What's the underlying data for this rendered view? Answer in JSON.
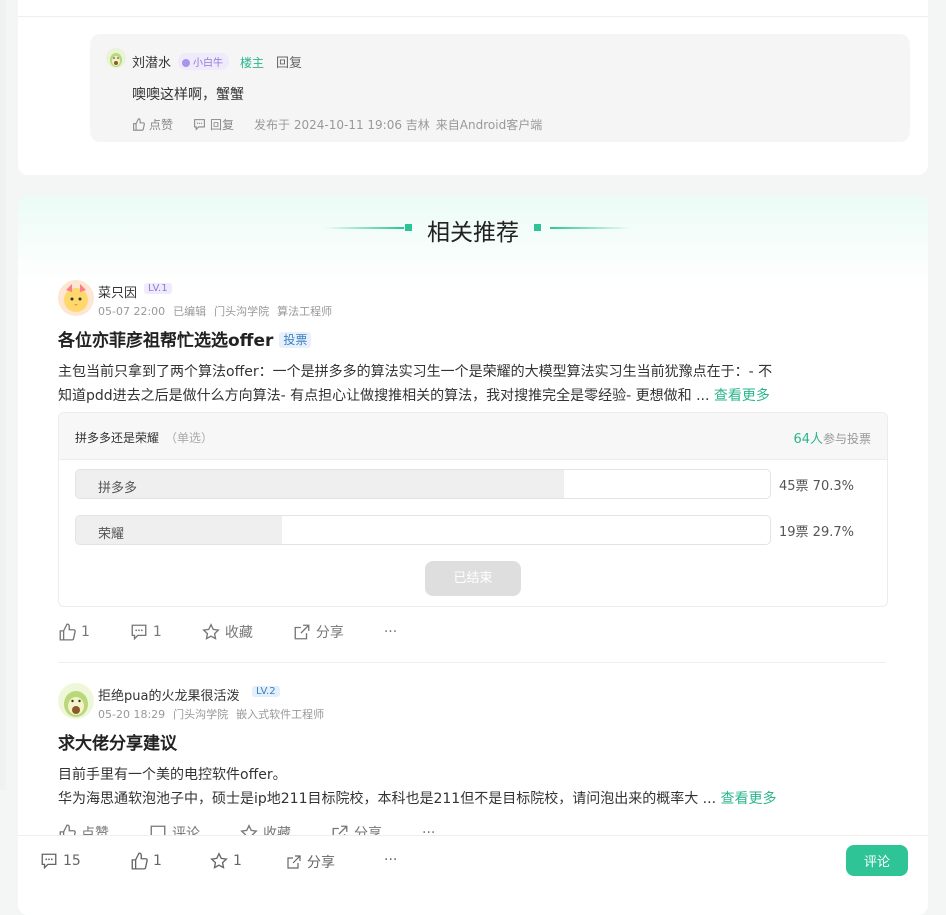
{
  "reply": {
    "username": "刘潜水",
    "badge": "小白牛",
    "role_tag": "楼主",
    "reply_link": "回复",
    "content": "噢噢这样啊，蟹蟹",
    "like_label": "点赞",
    "reply_label": "回复",
    "published": "发布于 2024-10-11 19:06 吉林",
    "client": "来自Android客户端"
  },
  "section": {
    "title": "相关推荐",
    "accent": "#2cc496"
  },
  "posts": [
    {
      "username": "菜只因",
      "level": "LV.1",
      "date": "05-07 22:00",
      "edited": "已编辑",
      "school": "门头沟学院",
      "job": "算法工程师",
      "title": "各位亦菲彦祖帮忙选选offer",
      "tag": "投票",
      "body_line1": "主包当前只拿到了两个算法offer：一个是拼多多的算法实习生一个是荣耀的大模型算法实习生当前犹豫点在于：- 不",
      "body_line2": "知道pdd进去之后是做什么方向算法- 有点担心让做搜推相关的算法，我对搜推完全是零经验- 更想做和 ...",
      "more": "查看更多",
      "poll": {
        "question": "拼多多还是荣耀",
        "mode": "（单选）",
        "participants": "64人",
        "participants_suffix": "参与投票",
        "options": [
          {
            "label": "拼多多",
            "result": "45票 70.3%",
            "share": 0.703
          },
          {
            "label": "荣耀",
            "result": "19票 29.7%",
            "share": 0.297
          }
        ],
        "ended": "已结束"
      },
      "actions": {
        "likes": "1",
        "comments": "1",
        "favorite": "收藏",
        "share": "分享",
        "more": "···"
      }
    },
    {
      "username": "拒绝pua的火龙果很活泼",
      "level": "LV.2",
      "date": "05-20 18:29",
      "school": "门头沟学院",
      "job": "嵌入式软件工程师",
      "title": "求大佬分享建议",
      "body_line1": "目前手里有一个美的电控软件offer。",
      "body_line2": "华为海思通软泡池子中，硕士是ip地211目标院校，本科也是211但不是目标院校，请问泡出来的概率大 ...",
      "more": "查看更多",
      "actions": {
        "likes": "点赞",
        "comments": "评论",
        "favorite": "收藏",
        "share": "分享",
        "more": "···"
      }
    }
  ],
  "bottom_bar": {
    "comments": "15",
    "likes": "1",
    "favorites": "1",
    "share": "分享",
    "more": "···",
    "comment_button": "评论"
  }
}
